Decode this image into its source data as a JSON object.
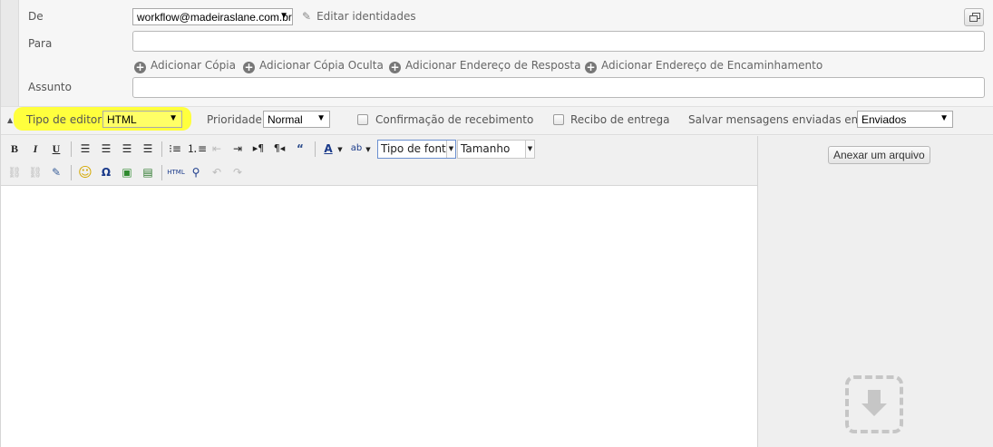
{
  "from": {
    "label": "De",
    "account": "workflow@madeiraslane.com.br",
    "edit_identities": "Editar identidades"
  },
  "to": {
    "label": "Para",
    "value": ""
  },
  "recipient_links": [
    "Adicionar Cópia",
    "Adicionar Cópia Oculta",
    "Adicionar Endereço de Resposta",
    "Adicionar Endereço de Encaminhamento"
  ],
  "subject": {
    "label": "Assunto",
    "value": ""
  },
  "options": {
    "editor_type_label": "Tipo de editor",
    "editor_type_value": "HTML",
    "priority_label": "Prioridade",
    "priority_value": "Normal",
    "read_receipt_label": "Confirmação de recebimento",
    "delivery_receipt_label": "Recibo de entrega",
    "save_sent_label": "Salvar mensagens enviadas em",
    "save_sent_value": "Enviados",
    "highlight_color": "#ffff33"
  },
  "toolbar": {
    "bold": "B",
    "italic": "I",
    "underline": "U",
    "font_family": "Tipo de fonte",
    "font_size": "Tamanho",
    "html_source": "HTML"
  },
  "attachments": {
    "attach_button": "Anexar um arquivo"
  }
}
